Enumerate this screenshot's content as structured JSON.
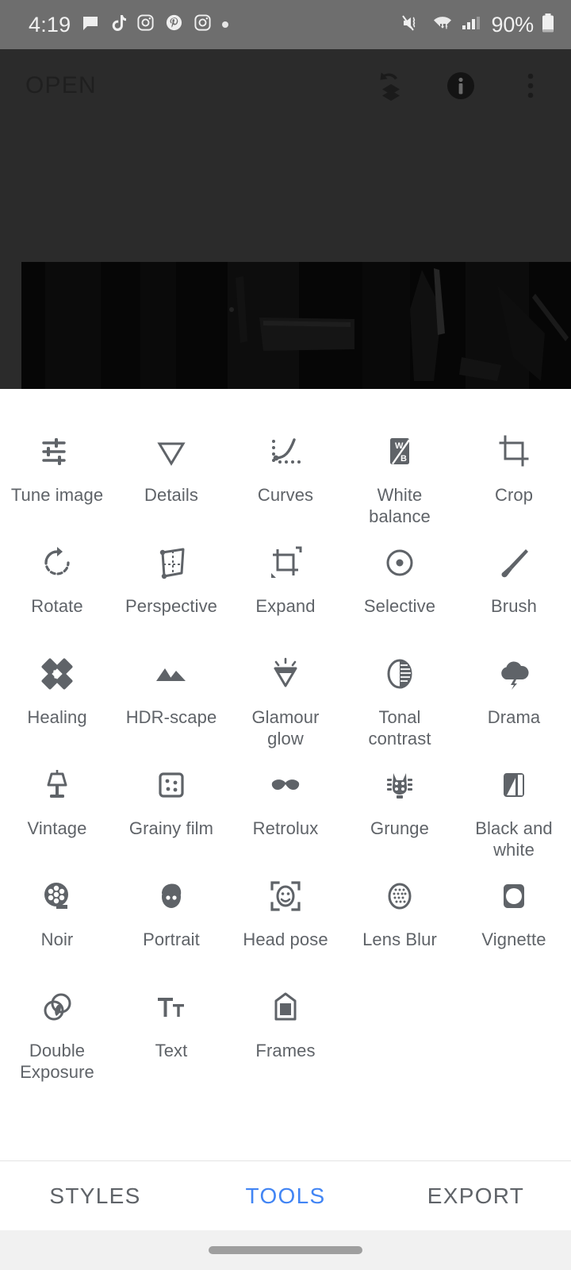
{
  "status_bar": {
    "time": "4:19",
    "battery_percent": "90%",
    "left_icons": [
      "message-icon",
      "tiktok-icon",
      "instagram-icon",
      "pinterest-icon",
      "instagram-icon",
      "dot-icon"
    ],
    "right_icons": [
      "volume-mute-vibrate-icon",
      "wifi-icon",
      "cell-signal-icon",
      "battery-icon"
    ],
    "background": "#6e6e6e"
  },
  "app_bar": {
    "title": "OPEN",
    "actions": [
      "undo-stack-icon",
      "info-icon",
      "overflow-menu-icon"
    ]
  },
  "editor": {
    "background": "#2b2b2b",
    "photo_description": "dark-photo-preview"
  },
  "tools": {
    "items": [
      {
        "label": "Tune image",
        "icon": "tune-sliders-icon"
      },
      {
        "label": "Details",
        "icon": "details-triangle-icon"
      },
      {
        "label": "Curves",
        "icon": "curves-icon"
      },
      {
        "label": "White balance",
        "icon": "white-balance-icon"
      },
      {
        "label": "Crop",
        "icon": "crop-icon"
      },
      {
        "label": "Rotate",
        "icon": "rotate-icon"
      },
      {
        "label": "Perspective",
        "icon": "perspective-icon"
      },
      {
        "label": "Expand",
        "icon": "expand-icon"
      },
      {
        "label": "Selective",
        "icon": "selective-icon"
      },
      {
        "label": "Brush",
        "icon": "brush-icon"
      },
      {
        "label": "Healing",
        "icon": "healing-icon"
      },
      {
        "label": "HDR-scape",
        "icon": "hdr-scape-mountains-icon"
      },
      {
        "label": "Glamour glow",
        "icon": "glamour-glow-gem-icon"
      },
      {
        "label": "Tonal contrast",
        "icon": "tonal-contrast-icon"
      },
      {
        "label": "Drama",
        "icon": "drama-cloud-icon"
      },
      {
        "label": "Vintage",
        "icon": "vintage-lamp-icon"
      },
      {
        "label": "Grainy film",
        "icon": "grainy-film-icon"
      },
      {
        "label": "Retrolux",
        "icon": "retrolux-moustache-icon"
      },
      {
        "label": "Grunge",
        "icon": "grunge-guitar-headstock-icon"
      },
      {
        "label": "Black and white",
        "icon": "black-and-white-icon"
      },
      {
        "label": "Noir",
        "icon": "noir-film-reel-icon"
      },
      {
        "label": "Portrait",
        "icon": "portrait-face-icon"
      },
      {
        "label": "Head pose",
        "icon": "head-pose-icon"
      },
      {
        "label": "Lens Blur",
        "icon": "lens-blur-icon"
      },
      {
        "label": "Vignette",
        "icon": "vignette-icon"
      },
      {
        "label": "Double Exposure",
        "icon": "double-exposure-icon"
      },
      {
        "label": "Text",
        "icon": "text-icon"
      },
      {
        "label": "Frames",
        "icon": "frames-icon"
      }
    ],
    "icon_color": "#5f6368",
    "label_color": "#5f6368"
  },
  "bottom_tabs": {
    "items": [
      {
        "label": "STYLES",
        "active": false
      },
      {
        "label": "TOOLS",
        "active": true
      },
      {
        "label": "EXPORT",
        "active": false
      }
    ],
    "active_color": "#4285f4",
    "inactive_color": "#5f6368"
  }
}
